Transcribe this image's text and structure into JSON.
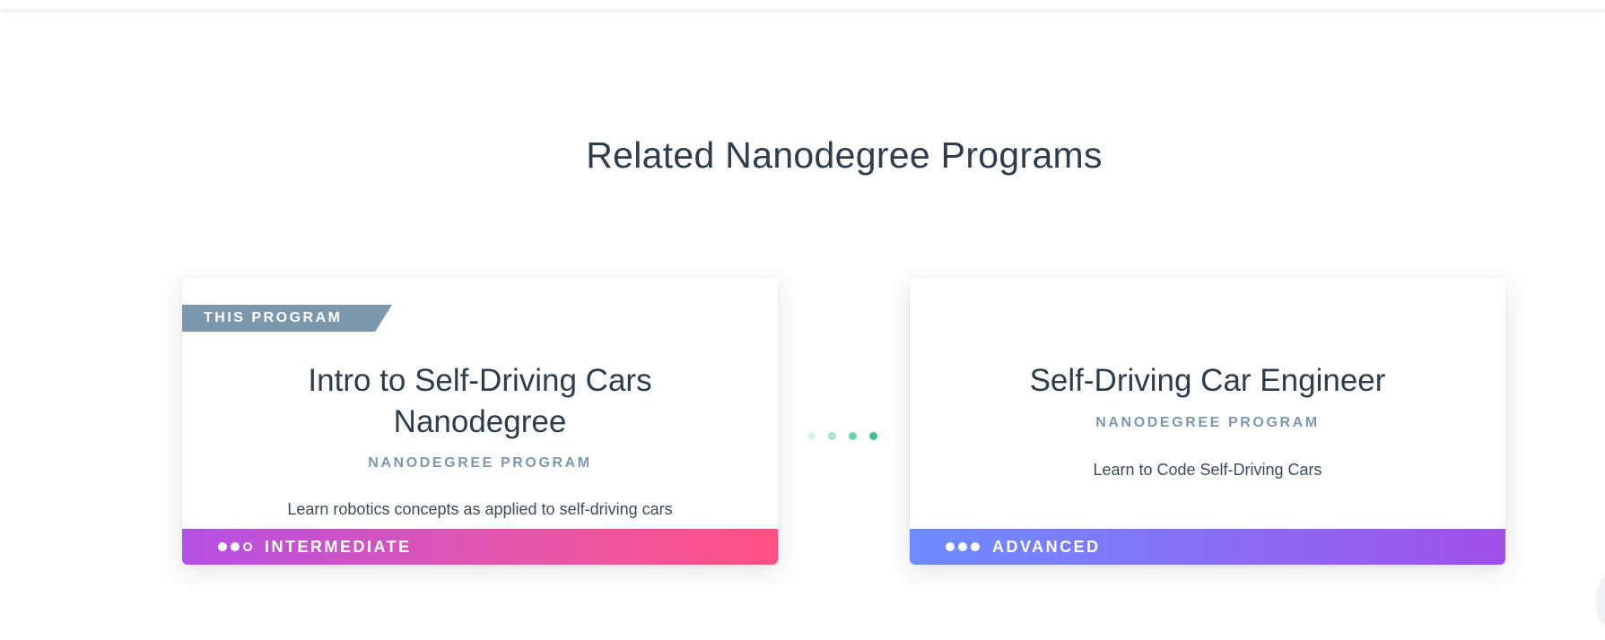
{
  "section": {
    "title": "Related Nanodegree Programs"
  },
  "cards": [
    {
      "ribbon": "THIS PROGRAM",
      "title_line1": "Intro to Self-Driving Cars",
      "title_line2": "Nanodegree",
      "subtitle": "NANODEGREE PROGRAM",
      "description": "Learn robotics concepts as applied to self-driving cars",
      "level": "INTERMEDIATE",
      "level_dots_filled": 2,
      "level_dots_total": 3
    },
    {
      "title": "Self-Driving Car Engineer",
      "subtitle": "NANODEGREE PROGRAM",
      "description": "Learn to Code Self-Driving Cars",
      "level": "ADVANCED",
      "level_dots_filled": 3,
      "level_dots_total": 3
    }
  ],
  "connector": {
    "dot_colors": [
      "#d6f3e6",
      "#a6e4c6",
      "#6fd3a2",
      "#3cc488"
    ]
  },
  "colors": {
    "ribbon": "#7d97ad",
    "title_text": "#2e3d49",
    "subtitle_text": "#7d97ad",
    "intermediate_gradient": [
      "#b450e6",
      "#ff5283"
    ],
    "advanced_gradient": [
      "#6c8cff",
      "#a04fe8"
    ]
  }
}
